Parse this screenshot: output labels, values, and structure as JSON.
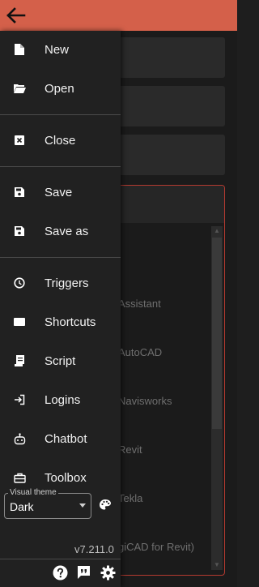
{
  "drawer": {
    "items": [
      {
        "label": "New"
      },
      {
        "label": "Open"
      },
      {
        "label": "Close"
      },
      {
        "label": "Save"
      },
      {
        "label": "Save as"
      },
      {
        "label": "Triggers"
      },
      {
        "label": "Shortcuts"
      },
      {
        "label": "Script"
      },
      {
        "label": "Logins"
      },
      {
        "label": "Chatbot"
      },
      {
        "label": "Toolbox"
      }
    ],
    "theme": {
      "legend": "Visual theme",
      "value": "Dark"
    },
    "version": "v7.211.0"
  },
  "background": {
    "items": [
      "Assistant",
      "AutoCAD",
      "Navisworks",
      "Revit",
      "Tekla",
      "giCAD for Revit)"
    ]
  },
  "colors": {
    "topbar": "#d4604a",
    "drawer": "#212121",
    "accent_border": "#b33a30"
  }
}
